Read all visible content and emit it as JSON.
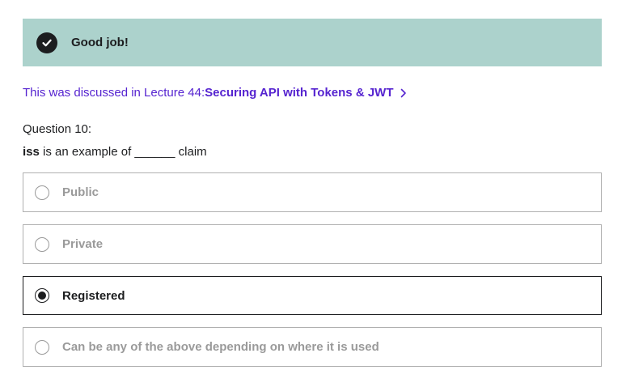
{
  "banner": {
    "text": "Good job!"
  },
  "lecture": {
    "prefix": "This was discussed in Lecture 44: ",
    "title": "Securing API with Tokens & JWT"
  },
  "question": {
    "number_label": "Question 10:",
    "term": "iss",
    "text_rest": " is an example of ______ claim"
  },
  "options": [
    {
      "label": "Public",
      "selected": false
    },
    {
      "label": "Private",
      "selected": false
    },
    {
      "label": "Registered",
      "selected": true
    },
    {
      "label": "Can be any of the above depending on where it is used",
      "selected": false
    }
  ],
  "colors": {
    "banner_bg": "#acd2cc",
    "link": "#5624d0",
    "text": "#1c1d1f",
    "muted": "#9a9a9a"
  },
  "icons": {
    "banner": "check-circle-icon",
    "lecture": "chevron-right-icon"
  }
}
